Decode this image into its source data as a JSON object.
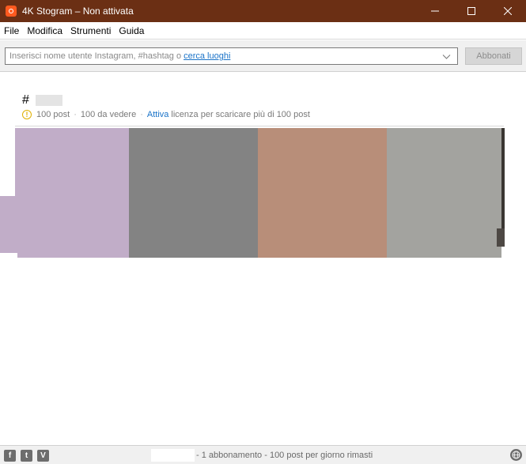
{
  "window": {
    "title": "4K Stogram – Non attivata",
    "accent_color": "#6b2f14",
    "app_icon": "stogram-app-icon"
  },
  "menu": {
    "items": [
      "File",
      "Modifica",
      "Strumenti",
      "Guida"
    ]
  },
  "search": {
    "placeholder": "Inserisci nome utente Instagram, #hashtag o",
    "link_text": "cerca luoghi",
    "subscribe_label": "Abbonati"
  },
  "hashtag": {
    "prefix": "#"
  },
  "stats": {
    "posts": "100 post",
    "to_view": "100 da vedere",
    "activate_link": "Attiva",
    "license_text": "licenza per scaricare più di 100 post",
    "separator": "·"
  },
  "thumbnails": [
    {
      "color": "#c1adc8"
    },
    {
      "color": "#838383"
    },
    {
      "color": "#b88e79"
    },
    {
      "color": "#a3a39f"
    },
    {
      "color": "#3a3632"
    }
  ],
  "statusbar": {
    "text": "- 1 abbonamento - 100 post per giorno rimasti",
    "social": [
      {
        "icon": "facebook-icon",
        "glyph": "f"
      },
      {
        "icon": "twitter-icon",
        "glyph": "t"
      },
      {
        "icon": "vimeo-icon",
        "glyph": "V"
      }
    ],
    "globe_icon": "globe-icon"
  }
}
